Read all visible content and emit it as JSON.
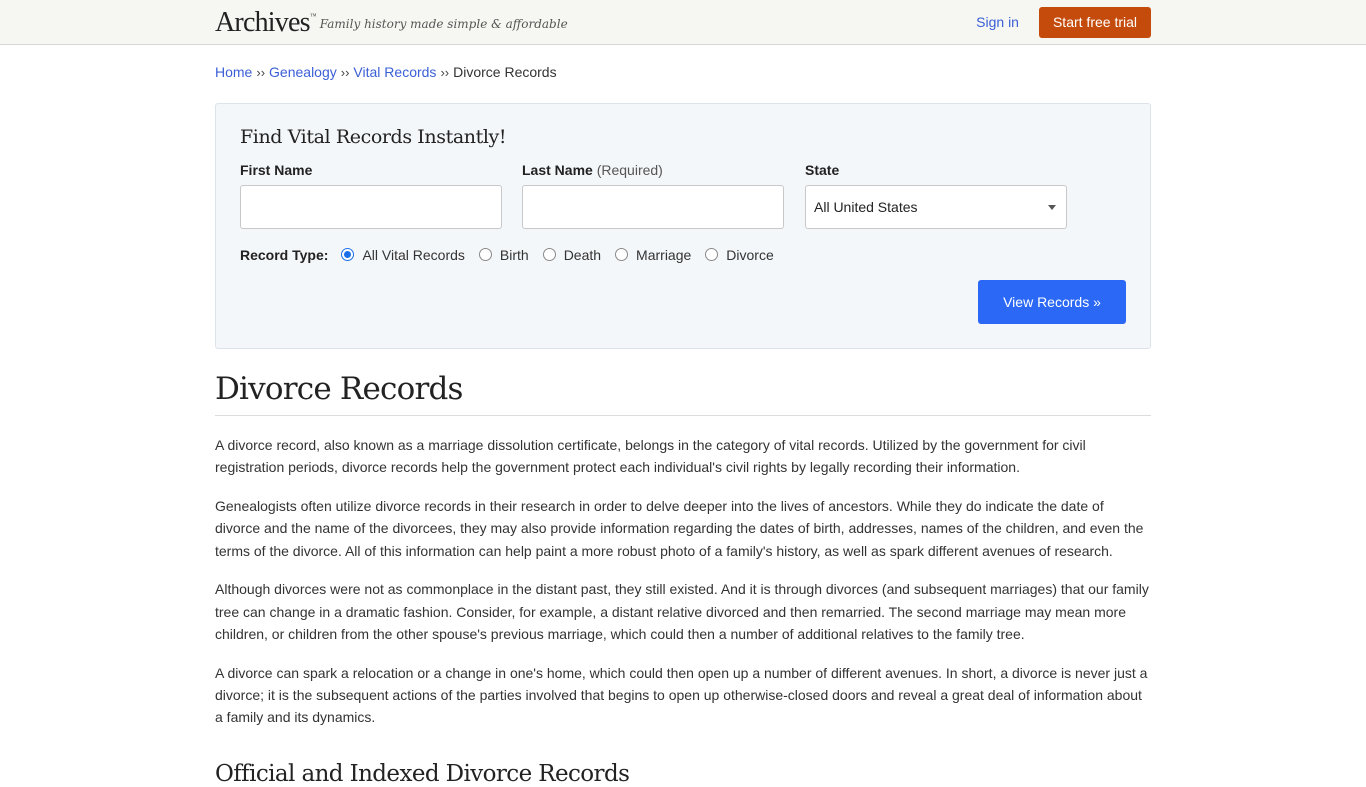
{
  "header": {
    "logo": "Archives",
    "logo_tm": "™",
    "tagline": "Family history made simple & affordable",
    "sign_in": "Sign in",
    "trial_button": "Start free trial"
  },
  "breadcrumb": {
    "items": [
      "Home",
      "Genealogy",
      "Vital Records"
    ],
    "separator": "››",
    "current": "Divorce Records"
  },
  "search": {
    "title": "Find Vital Records Instantly!",
    "first_name_label": "First Name",
    "first_name_value": "",
    "last_name_label": "Last Name",
    "last_name_required": "(Required)",
    "last_name_value": "",
    "state_label": "State",
    "state_value": "All United States",
    "record_type_label": "Record Type:",
    "record_types": [
      "All Vital Records",
      "Birth",
      "Death",
      "Marriage",
      "Divorce"
    ],
    "selected_record_type": "All Vital Records",
    "submit": "View Records »"
  },
  "article": {
    "title": "Divorce Records",
    "paragraphs": [
      "A divorce record, also known as a marriage dissolution certificate, belongs in the category of vital records. Utilized by the government for civil registration periods, divorce records help the government protect each individual's civil rights by legally recording their information.",
      "Genealogists often utilize divorce records in their research in order to delve deeper into the lives of ancestors. While they do indicate the date of divorce and the name of the divorcees, they may also provide information regarding the dates of birth, addresses, names of the children, and even the terms of the divorce. All of this information can help paint a more robust photo of a family's history, as well as spark different avenues of research.",
      "Although divorces were not as commonplace in the distant past, they still existed. And it is through divorces (and subsequent marriages) that our family tree can change in a dramatic fashion. Consider, for example, a distant relative divorced and then remarried. The second marriage may mean more children, or children from the other spouse's previous marriage, which could then a number of additional relatives to the family tree.",
      "A divorce can spark a relocation or a change in one's home, which could then open up a number of different avenues. In short, a divorce is never just a divorce; it is the subsequent actions of the parties involved that begins to open up otherwise-closed doors and reveal a great deal of information about a family and its dynamics."
    ],
    "subheading": "Official and Indexed Divorce Records"
  },
  "colors": {
    "link": "#3b5fd6",
    "trial_button": "#c44b0c",
    "primary_button": "#2a68f5",
    "search_panel_bg": "#f4f7fa",
    "topbar_bg": "#f6f6f3"
  }
}
